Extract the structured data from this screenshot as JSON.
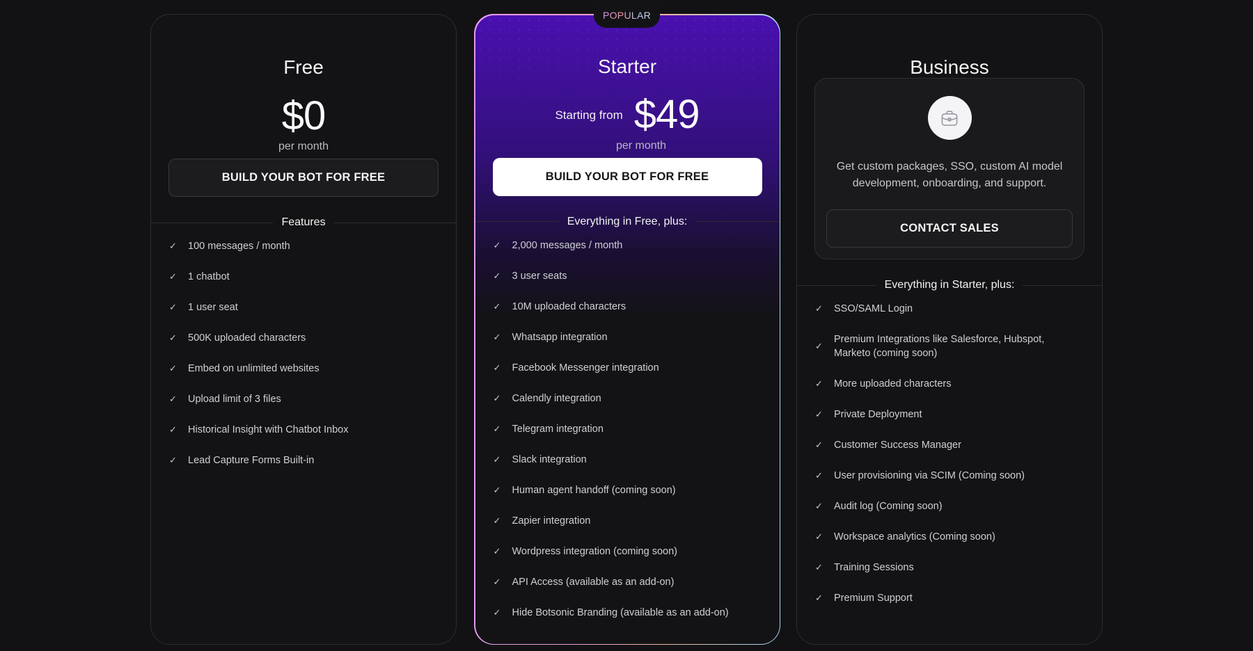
{
  "badge": {
    "popular": "POPULAR"
  },
  "plans": {
    "free": {
      "title": "Free",
      "price": "$0",
      "period": "per month",
      "cta": "BUILD YOUR BOT FOR FREE",
      "features_heading": "Features",
      "features": [
        "100 messages / month",
        "1 chatbot",
        "1 user seat",
        "500K uploaded characters",
        "Embed on unlimited websites",
        "Upload limit of 3 files",
        "Historical Insight with Chatbot Inbox",
        "Lead Capture Forms Built-in"
      ]
    },
    "starter": {
      "title": "Starter",
      "price_prefix": "Starting from",
      "price": "$49",
      "period": "per month",
      "cta": "BUILD YOUR BOT FOR FREE",
      "features_heading": "Everything in Free, plus:",
      "features": [
        "2,000 messages / month",
        "3 user seats",
        "10M uploaded characters",
        "Whatsapp integration",
        "Facebook Messenger integration",
        "Calendly integration",
        "Telegram integration",
        "Slack integration",
        "Human agent handoff (coming soon)",
        "Zapier integration",
        "Wordpress integration (coming soon)",
        "API Access (available as an add-on)",
        "Hide Botsonic Branding (available as an add-on)"
      ]
    },
    "business": {
      "title": "Business",
      "icon": "briefcase-icon",
      "description": "Get custom packages, SSO, custom AI model development, onboarding, and support.",
      "cta": "CONTACT SALES",
      "features_heading": "Everything in Starter, plus:",
      "features": [
        "SSO/SAML Login",
        "Premium Integrations like Salesforce, Hubspot, Marketo (coming soon)",
        "More uploaded characters",
        "Private Deployment",
        "Customer Success Manager",
        "User provisioning via SCIM (Coming soon)",
        "Audit log (Coming soon)",
        "Workspace analytics (Coming soon)",
        "Training Sessions",
        "Premium Support"
      ]
    }
  },
  "colors": {
    "background": "#121214",
    "starter_accent": "#4a10b0",
    "cta_light": "#ffffff",
    "cta_dark": "#1c1c1f"
  }
}
